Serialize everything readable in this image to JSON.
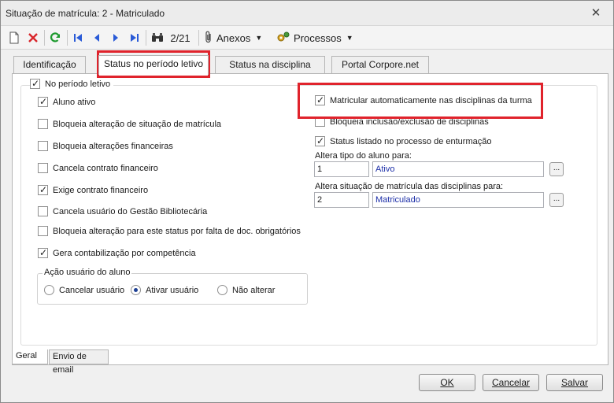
{
  "window": {
    "title": "Situação de matrícula: 2 - Matriculado",
    "close_label": "✕"
  },
  "toolbar": {
    "record_position": "2/21",
    "attachments_label": "Anexos",
    "processes_label": "Processos",
    "icons": [
      "new-document-icon",
      "delete-icon",
      "refresh-icon",
      "first-record-icon",
      "previous-record-icon",
      "next-record-icon",
      "last-record-icon",
      "binoculars-icon",
      "paperclip-icon",
      "processes-gear-icon"
    ]
  },
  "tabs": [
    {
      "label": "Identificação"
    },
    {
      "label": "Status no período letivo"
    },
    {
      "label": "Status na disciplina"
    },
    {
      "label": "Portal Corpore.net"
    }
  ],
  "left_section": {
    "header": {
      "label": "No período letivo",
      "checked": true
    },
    "options": [
      {
        "label": "Aluno ativo",
        "checked": true
      },
      {
        "label": "Bloqueia alteração de situação de matrícula",
        "checked": false
      },
      {
        "label": "Bloqueia alterações financeiras",
        "checked": false
      },
      {
        "label": "Cancela contrato financeiro",
        "checked": false
      },
      {
        "label": "Exige contrato financeiro",
        "checked": true
      },
      {
        "label": "Cancela usuário do Gestão Bibliotecária",
        "checked": false
      },
      {
        "label": "Bloqueia alteração para este status por falta de doc. obrigatórios",
        "checked": false
      },
      {
        "label": "Gera contabilização por competência",
        "checked": true
      }
    ],
    "student_user_action": {
      "title": "Ação usuário do aluno",
      "options": [
        {
          "label": "Cancelar usuário",
          "selected": false
        },
        {
          "label": "Ativar usuário",
          "selected": true
        },
        {
          "label": "Não alterar",
          "selected": false
        }
      ]
    }
  },
  "right_section": {
    "auto_enroll": {
      "label": "Matricular automaticamente nas disciplinas da turma",
      "checked": true
    },
    "block_inclusion": {
      "label": "Bloqueia inclusão/exclusão de disciplinas",
      "checked": false
    },
    "listed_in_process": {
      "label": "Status listado no processo de enturmação",
      "checked": true
    },
    "student_type": {
      "label": "Altera tipo do aluno para:",
      "code": "1",
      "description": "Ativo"
    },
    "discipline_status": {
      "label": "Altera situação de matrícula das disciplinas para:",
      "code": "2",
      "description": "Matriculado"
    },
    "lookup_label": "..."
  },
  "subtabs": [
    {
      "label": "Geral"
    },
    {
      "label": "Envio de email"
    }
  ],
  "buttons": {
    "ok": "OK",
    "cancel": "Cancelar",
    "save": "Salvar"
  },
  "colors": {
    "highlight": "#e0232c",
    "value_text": "#1d2fa8"
  }
}
